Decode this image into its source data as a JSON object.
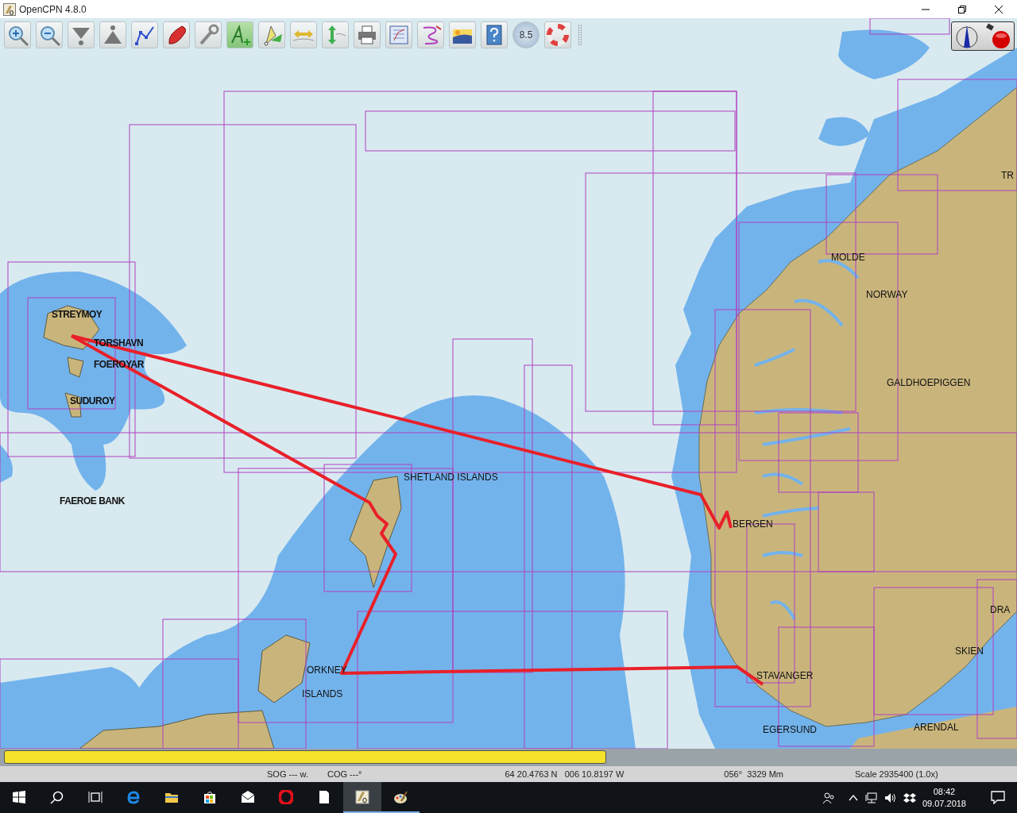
{
  "window": {
    "title": "OpenCPN 4.8.0"
  },
  "toolbar": [
    {
      "active": false
    },
    {
      "active": false
    },
    {
      "active": false
    },
    {
      "active": false
    },
    {
      "active": false
    },
    {
      "active": false
    },
    {
      "active": false
    },
    {
      "active": true
    },
    {
      "active": false
    },
    {
      "active": false
    },
    {
      "active": false
    },
    {
      "active": false
    },
    {
      "active": false
    },
    {
      "active": false
    },
    {
      "active": false
    },
    {
      "active": false
    },
    {
      "active": false
    },
    {
      "active": false
    }
  ],
  "tide_button": {
    "label": "8.5"
  },
  "map_labels": [
    {
      "text": "STREYMOY",
      "bold": true
    },
    {
      "text": "TORSHAVN",
      "bold": true
    },
    {
      "text": "FOEROYAR",
      "bold": true
    },
    {
      "text": "SUDUROY",
      "bold": true
    },
    {
      "text": "FAEROE BANK",
      "bold": true
    },
    {
      "text": "SHETLAND ISLANDS",
      "bold": false
    },
    {
      "text": "ORKNEY",
      "bold": false
    },
    {
      "text": "ISLANDS",
      "bold": false
    },
    {
      "text": "BERGEN",
      "bold": false
    },
    {
      "text": "STAVANGER",
      "bold": false
    },
    {
      "text": "EGERSUND",
      "bold": false
    },
    {
      "text": "MOLDE",
      "bold": false
    },
    {
      "text": "NORWAY",
      "bold": false
    },
    {
      "text": "GALDHOEPIGGEN",
      "bold": false
    },
    {
      "text": "SKIEN",
      "bold": false
    },
    {
      "text": "ARENDAL",
      "bold": false
    },
    {
      "text": "DRA",
      "bold": false
    },
    {
      "text": "TR",
      "bold": false
    }
  ],
  "progress": {
    "level": 0.597
  },
  "status_bar": [
    "SOG --- w.",
    "COG ---°",
    "64 20.4763 N   006 10.8197 W",
    "056°  3329 Mm",
    "Scale 2935400 (1.0x)"
  ],
  "taskbar": {
    "apps": [
      {
        "running": false,
        "selected": false
      },
      {
        "running": false,
        "selected": false
      },
      {
        "running": false,
        "selected": false
      },
      {
        "running": false,
        "selected": false
      },
      {
        "running": false,
        "selected": false
      },
      {
        "running": false,
        "selected": false
      },
      {
        "running": true,
        "selected": true
      },
      {
        "running": true,
        "selected": false
      }
    ],
    "time": "08:42",
    "date": "09.07.2018"
  }
}
